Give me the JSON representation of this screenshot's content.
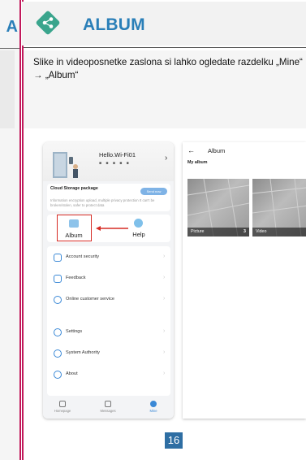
{
  "previous_title": "A",
  "header": {
    "title": "ALBUM",
    "icon": "share-icon",
    "icon_color": "#3aa58d",
    "title_color": "#2a7fb8",
    "accent_color": "#c2185b"
  },
  "description": "Slike in videoposnetke zaslona si lahko ogledate razdelku „Mine“ → „Album“",
  "phone_mine": {
    "greeting": "Hello.Wi-Fi01",
    "dots": "■ ■ ■ ■ ■",
    "chevron": "›",
    "cloud": {
      "title": "Cloud Storage package",
      "button": "Send now",
      "subtitle": "Information encryption upload, multiple privacy protection It can't be broken/stolen, safer to protect data"
    },
    "tiles": [
      "Album",
      "Help"
    ],
    "menu": [
      "Account security",
      "Feedback",
      "Online customer service",
      "Settings",
      "System Authority",
      "About"
    ],
    "menu_chevron": "›",
    "tabs": [
      "Homepage",
      "Messages",
      "Mine"
    ]
  },
  "phone_album": {
    "back": "←",
    "title": "Album",
    "section": "My album",
    "items": [
      {
        "name": "Picture",
        "count": "3"
      },
      {
        "name": "Video",
        "count": "2"
      }
    ]
  },
  "page_number": "16"
}
